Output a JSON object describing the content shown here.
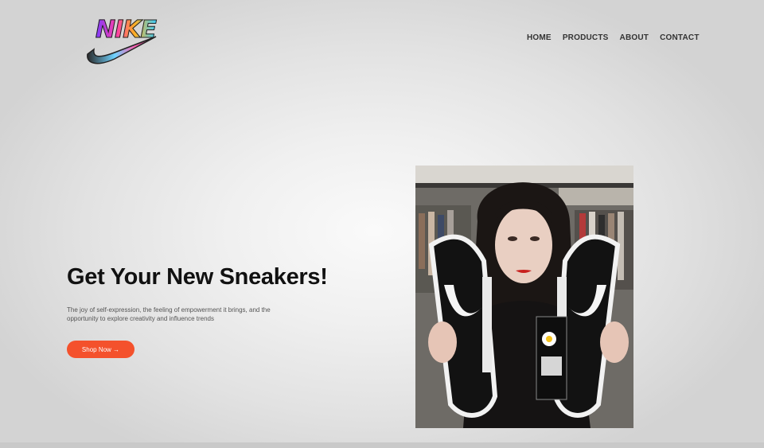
{
  "brand": {
    "logo_text": "NIKE"
  },
  "nav": {
    "items": [
      {
        "label": "HOME"
      },
      {
        "label": "PRODUCTS"
      },
      {
        "label": "ABOUT"
      },
      {
        "label": "CONTACT"
      }
    ]
  },
  "hero": {
    "title": "Get Your New Sneakers!",
    "description": "The joy of self-expression, the feeling of empowerment it brings, and the opportunity to explore creativity and influence trends",
    "cta_label": "Shop Now →",
    "cta_color": "#f4512c"
  },
  "image": {
    "subject": "woman-holding-sneakers-photo"
  }
}
